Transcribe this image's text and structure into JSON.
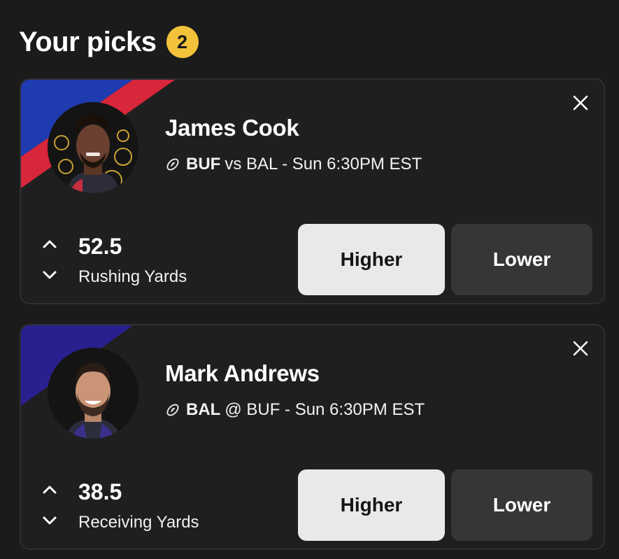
{
  "header": {
    "title": "Your picks",
    "count": "2"
  },
  "colors": {
    "badge": "#f2c23a",
    "bills_blue": "#1f3bb0",
    "bills_red": "#d8263a",
    "ravens_purple": "#2a1f8f",
    "higher_bg": "#e9e9e9",
    "lower_bg": "#363637"
  },
  "picks": [
    {
      "player": "James Cook",
      "team": "BUF",
      "matchup_rest": "vs BAL - Sun 6:30PM EST",
      "line": "52.5",
      "stat": "Rushing Yards",
      "higher_label": "Higher",
      "lower_label": "Lower",
      "sport_icon": "football-icon",
      "close_icon": "close-icon"
    },
    {
      "player": "Mark Andrews",
      "team": "BAL",
      "matchup_rest": "@ BUF - Sun 6:30PM EST",
      "line": "38.5",
      "stat": "Receiving Yards",
      "higher_label": "Higher",
      "lower_label": "Lower",
      "sport_icon": "football-icon",
      "close_icon": "close-icon"
    }
  ]
}
